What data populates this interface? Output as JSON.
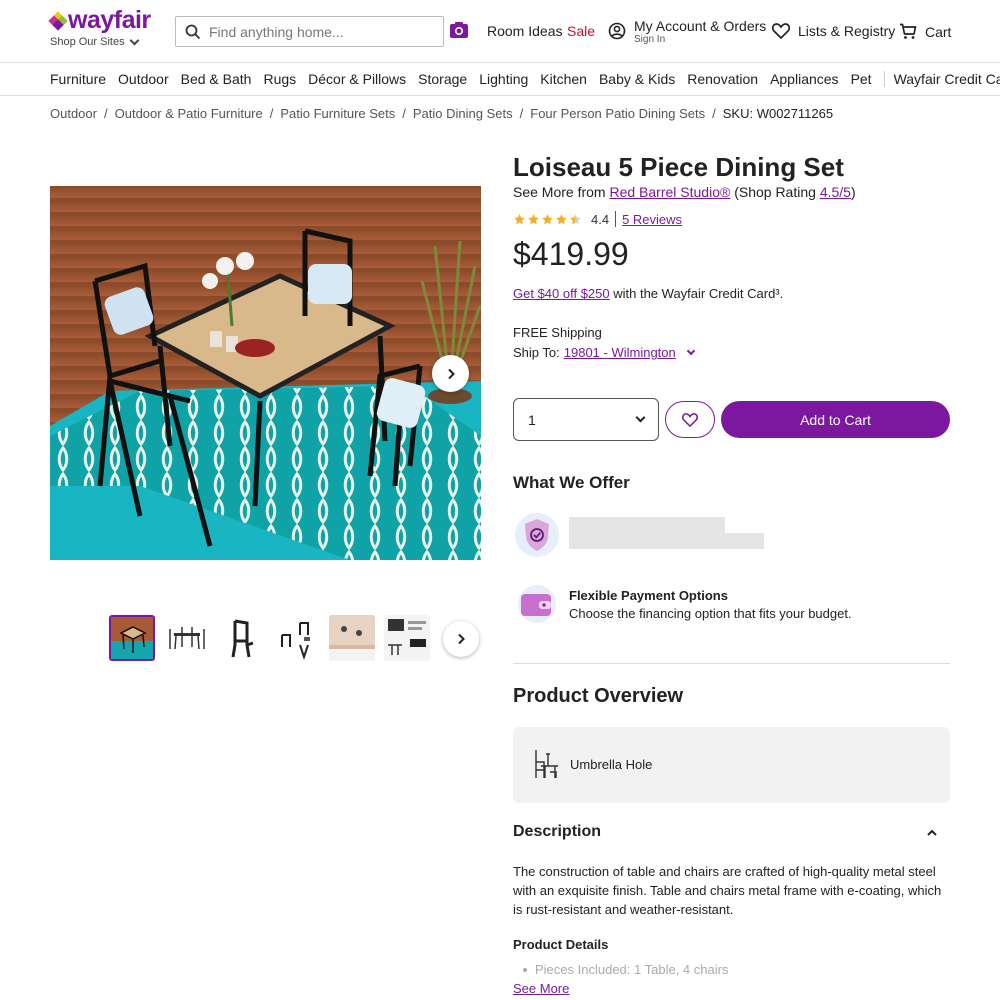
{
  "brand": {
    "logo_text": "wayfair",
    "shop_sites": "Shop Our Sites",
    "accent": "#7b189f",
    "sale_color": "#c0102f"
  },
  "search": {
    "placeholder": "Find anything home..."
  },
  "header": {
    "room_ideas": "Room Ideas",
    "sale": "Sale",
    "account_title": "My Account & Orders",
    "account_sub": "Sign In",
    "lists": "Lists & Registry",
    "cart": "Cart"
  },
  "categories": [
    "Furniture",
    "Outdoor",
    "Bed & Bath",
    "Rugs",
    "Décor & Pillows",
    "Storage",
    "Lighting",
    "Kitchen",
    "Baby & Kids",
    "Renovation",
    "Appliances",
    "Pet"
  ],
  "credit_card_nav": "Wayfair Credit Card",
  "breadcrumb": [
    "Outdoor",
    "Outdoor & Patio Furniture",
    "Patio Furniture Sets",
    "Patio Dining Sets",
    "Four Person Patio Dining Sets"
  ],
  "sku": "SKU: W002711265",
  "product": {
    "title": "Loiseau 5 Piece Dining Set",
    "see_more_prefix": "See More from ",
    "brand": "Red Barrel Studio®",
    "shop_rating_prefix": " (Shop Rating ",
    "shop_rating": "4.5/5",
    "shop_rating_suffix": ")",
    "rating": "4.4",
    "rating_value": 4.4,
    "reviews": "5 Reviews",
    "price": "$419.99",
    "credit_link": "Get $40 off $250",
    "credit_text": " with the Wayfair Credit Card³.",
    "shipping": "FREE Shipping",
    "ship_to_label": "Ship To:",
    "ship_to_value": "19801 - Wilmington",
    "quantity": "1",
    "add_to_cart": "Add to Cart"
  },
  "offer": {
    "heading": "What We Offer",
    "payment_title": "Flexible Payment Options",
    "payment_desc": "Choose the financing option that fits your budget."
  },
  "overview": {
    "heading": "Product Overview",
    "feature": "Umbrella Hole"
  },
  "description": {
    "heading": "Description",
    "text": "The construction of table and chairs are crafted of high-quality metal steel with an exquisite finish. Table and chairs metal frame with e-coating, which is rust-resistant and weather-resistant.",
    "details_heading": "Product Details",
    "details_item": "Pieces Included: 1 Table, 4 chairs",
    "see_more": "See More"
  },
  "icons": [
    "search-icon",
    "camera-icon",
    "account-icon",
    "heart-icon",
    "cart-icon",
    "chevron-right-icon",
    "star-icon",
    "shield-check-icon",
    "wallet-icon",
    "umbrella-table-icon",
    "chevron-up-icon"
  ]
}
